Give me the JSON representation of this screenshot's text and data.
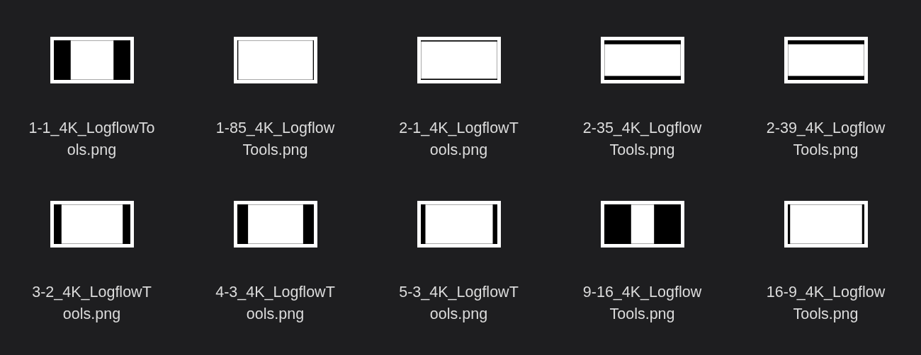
{
  "files": [
    {
      "name_lines": [
        "1-1_4K_LogflowTo",
        "ols.png"
      ]
    },
    {
      "name_lines": [
        "1-85_4K_Logflow",
        "Tools.png"
      ]
    },
    {
      "name_lines": [
        "2-1_4K_LogflowT",
        "ools.png"
      ]
    },
    {
      "name_lines": [
        "2-35_4K_Logflow",
        "Tools.png"
      ]
    },
    {
      "name_lines": [
        "2-39_4K_Logflow",
        "Tools.png"
      ]
    },
    {
      "name_lines": [
        "3-2_4K_LogflowT",
        "ools.png"
      ]
    },
    {
      "name_lines": [
        "4-3_4K_LogflowT",
        "ools.png"
      ]
    },
    {
      "name_lines": [
        "5-3_4K_LogflowT",
        "ools.png"
      ]
    },
    {
      "name_lines": [
        "9-16_4K_Logflow",
        "Tools.png"
      ]
    },
    {
      "name_lines": [
        "16-9_4K_Logflow",
        "Tools.png"
      ]
    }
  ]
}
